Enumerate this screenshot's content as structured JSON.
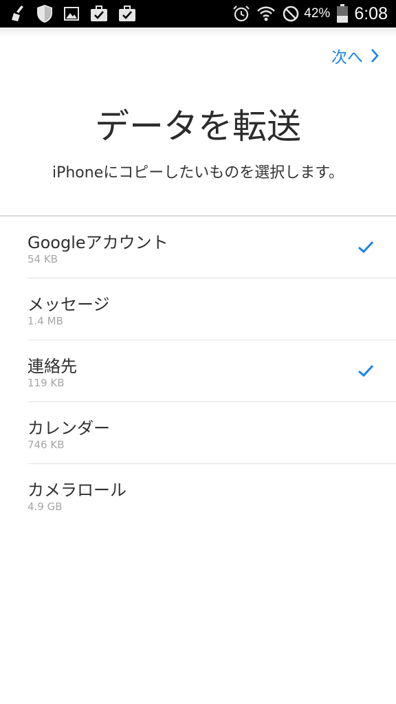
{
  "status_bar": {
    "left_icons": [
      "broom-icon",
      "shield-icon",
      "image-icon",
      "briefcase-check-icon",
      "briefcase-check-icon"
    ],
    "right_icons": [
      "alarm-icon",
      "wifi-icon",
      "do-not-disturb-icon"
    ],
    "battery_percent": "42%",
    "battery_level": 0.42,
    "time": "6:08"
  },
  "header": {
    "next_label": "次へ"
  },
  "page": {
    "title": "データを転送",
    "subtitle": "iPhoneにコピーしたいものを選択します。"
  },
  "items": [
    {
      "name": "Googleアカウント",
      "size": "54 KB",
      "checked": true
    },
    {
      "name": "メッセージ",
      "size": "1.4 MB",
      "checked": false
    },
    {
      "name": "連絡先",
      "size": "119 KB",
      "checked": true
    },
    {
      "name": "カレンダー",
      "size": "746 KB",
      "checked": false
    },
    {
      "name": "カメラロール",
      "size": "4.9 GB",
      "checked": false
    }
  ],
  "colors": {
    "accent": "#1a82e8",
    "status_bar_bg": "#000000",
    "text_primary": "#2f2f2f",
    "text_secondary": "#a6a6a6"
  }
}
